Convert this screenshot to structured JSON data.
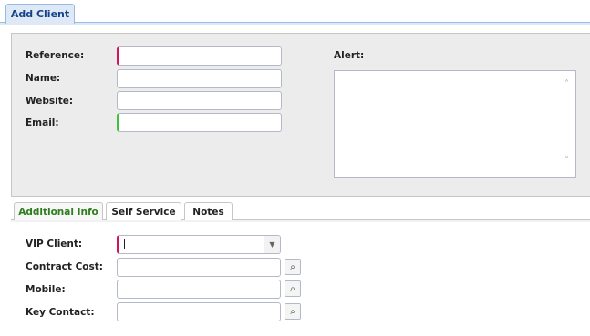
{
  "window": {
    "tab_title": "Add Client"
  },
  "header_form": {
    "reference_label": "Reference:",
    "reference_value": "",
    "name_label": "Name:",
    "name_value": "",
    "website_label": "Website:",
    "website_value": "",
    "email_label": "Email:",
    "email_value": "",
    "alert_label": "Alert:",
    "alert_value": ""
  },
  "tabs": [
    {
      "label": "Additional Info",
      "active": true
    },
    {
      "label": "Self Service",
      "active": false
    },
    {
      "label": "Notes",
      "active": false
    }
  ],
  "additional_info": {
    "vip_label": "VIP Client:",
    "vip_value": "",
    "contract_cost_label": "Contract Cost:",
    "contract_cost_value": "",
    "mobile_label": "Mobile:",
    "mobile_value": "",
    "key_contact_label": "Key Contact:",
    "key_contact_value": ""
  },
  "icons": {
    "combo_trigger": "chevron-down-icon",
    "lookup": "search-icon",
    "scroll_up": "chevron-up-icon",
    "scroll_down": "chevron-down-icon"
  },
  "colors": {
    "required_marker": "#d4145a",
    "valid_marker": "#3ec23e",
    "active_tab_text": "#2e7d1f",
    "top_tab_text": "#15428b",
    "panel_bg": "#ececec"
  }
}
